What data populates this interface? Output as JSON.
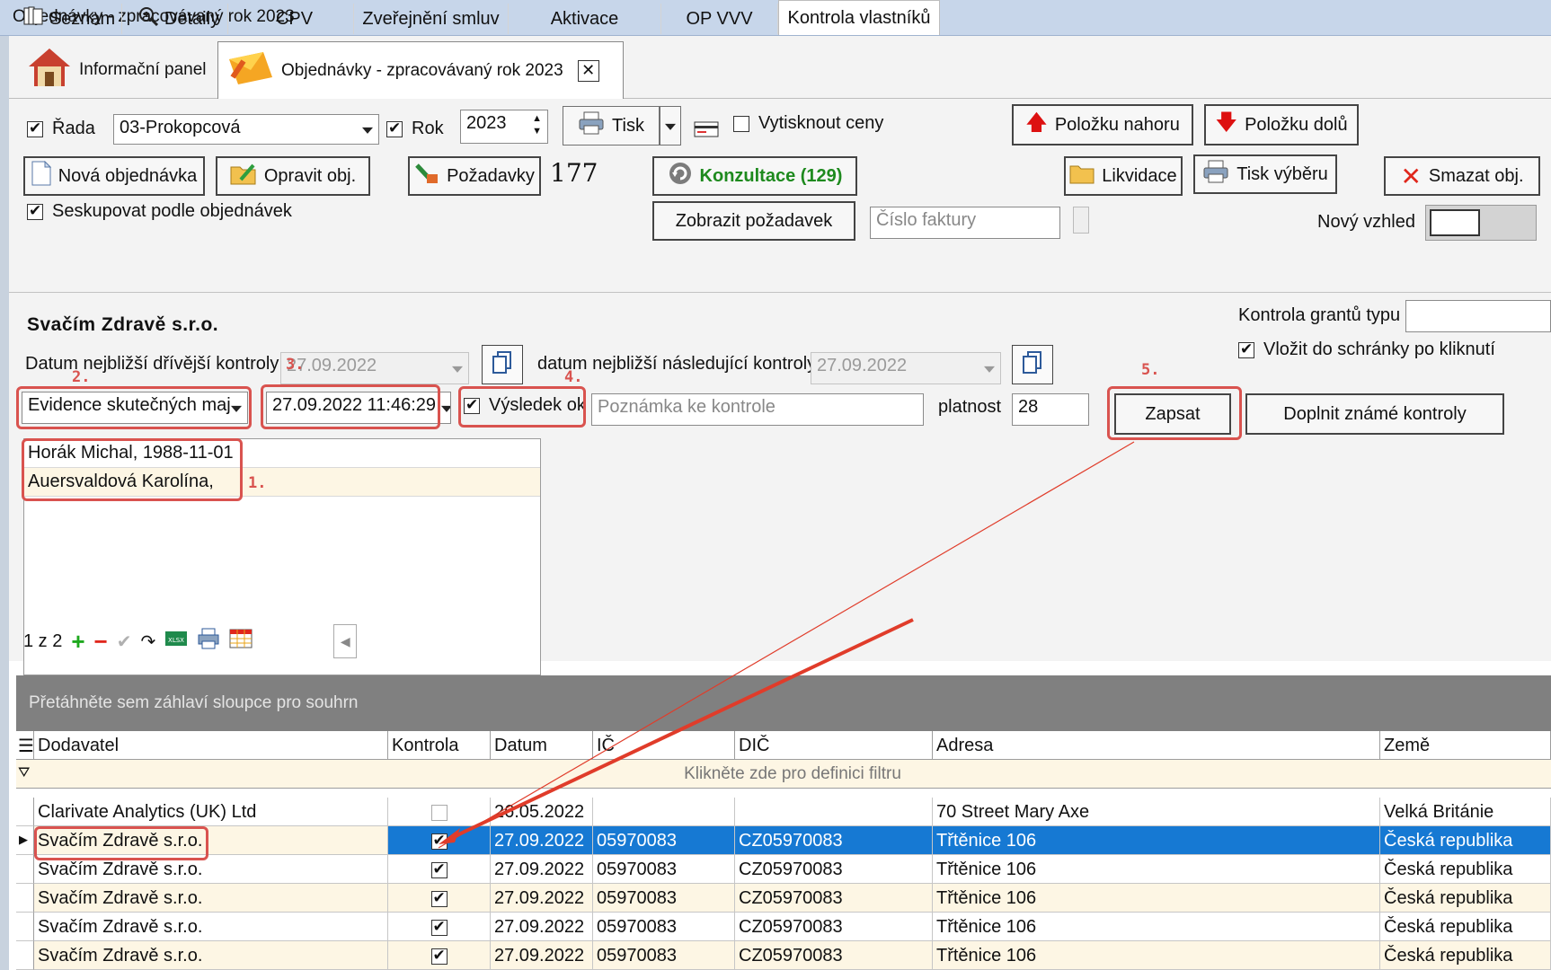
{
  "window": {
    "title": "Objednávky - zpracovávaný rok 2023"
  },
  "doc_tabs": {
    "info_panel": "Informační panel",
    "orders": "Objednávky - zpracovávaný rok 2023"
  },
  "toolbar": {
    "rada_label": "Řada",
    "rada_value": "03-Prokopcová",
    "rok_label": "Rok",
    "rok_value": "2023",
    "tisk": "Tisk",
    "vytisknout_ceny": "Vytisknout ceny",
    "polozku_nahoru": "Položku nahoru",
    "polozku_dolu": "Položku dolů",
    "nova_objednavka": "Nová objednávka",
    "opravit_obj": "Opravit obj.",
    "pozadavky": "Požadavky",
    "pozadavky_count": "177",
    "konzultace": "Konzultace (129)",
    "likvidace": "Likvidace",
    "tisk_vyberu": "Tisk výběru",
    "smazat_obj": "Smazat obj.",
    "seskupovat": "Seskupovat podle objednávek",
    "zobrazit_pozadavek": "Zobrazit požadavek",
    "cislo_faktury_placeholder": "Číslo faktury",
    "novy_vzhled": "Nový vzhled"
  },
  "tabs": [
    "Seznam",
    "Detaily",
    "CPV",
    "Zveřejnění smluv",
    "Aktivace",
    "OP VVV",
    "Kontrola vlastníků"
  ],
  "panel": {
    "company": "Svačím Zdravě s.r.o.",
    "prev_control_label": "Datum nejbližší dřívější kontroly",
    "prev_control_value": "27.09.2022",
    "next_control_label": "datum nejbližší následující kontroly",
    "next_control_value": "27.09.2022",
    "grant_type_label": "Kontrola grantů typu",
    "clipboard_label": "Vložit do schránky po kliknutí",
    "evidence_value": "Evidence skutečných maj",
    "datetime_value": "27.09.2022 11:46:29",
    "result_label": "Výsledek ok",
    "note_placeholder": "Poznámka ke kontrole",
    "platnost_label": "platnost",
    "platnost_value": "28",
    "zapsat": "Zapsat",
    "doplnit": "Doplnit známé kontroly",
    "owners": [
      "Horák Michal, 1988-11-01",
      "Auersvaldová Karolína,"
    ],
    "nav_count": "1 z 2"
  },
  "annotations": [
    "1.",
    "2.",
    "3.",
    "4.",
    "5."
  ],
  "grid": {
    "group_hint": "Přetáhněte sem záhlaví sloupce pro souhrn",
    "filter_hint": "Klikněte zde pro definici filtru",
    "columns": [
      "Dodavatel",
      "Kontrola",
      "Datum",
      "IČ",
      "DIČ",
      "Adresa",
      "Země"
    ],
    "rows": [
      {
        "dodavatel": "Clarivate Analytics (UK) Ltd",
        "kontrola": false,
        "datum": "26.05.2022",
        "ic": "",
        "dic": "",
        "adresa": "70 Street Mary Axe",
        "zeme": "Velká Británie"
      },
      {
        "dodavatel": "Svačím Zdravě s.r.o.",
        "kontrola": true,
        "datum": "27.09.2022",
        "ic": "05970083",
        "dic": "CZ05970083",
        "adresa": "Třtěnice 106",
        "zeme": "Česká republika"
      },
      {
        "dodavatel": "Svačím Zdravě s.r.o.",
        "kontrola": true,
        "datum": "27.09.2022",
        "ic": "05970083",
        "dic": "CZ05970083",
        "adresa": "Třtěnice 106",
        "zeme": "Česká republika"
      },
      {
        "dodavatel": "Svačím Zdravě s.r.o.",
        "kontrola": true,
        "datum": "27.09.2022",
        "ic": "05970083",
        "dic": "CZ05970083",
        "adresa": "Třtěnice 106",
        "zeme": "Česká republika"
      },
      {
        "dodavatel": "Svačím Zdravě s.r.o.",
        "kontrola": true,
        "datum": "27.09.2022",
        "ic": "05970083",
        "dic": "CZ05970083",
        "adresa": "Třtěnice 106",
        "zeme": "Česká republika"
      },
      {
        "dodavatel": "Svačím Zdravě s.r.o.",
        "kontrola": true,
        "datum": "27.09.2022",
        "ic": "05970083",
        "dic": "CZ05970083",
        "adresa": "Třtěnice 106",
        "zeme": "Česká republika"
      }
    ]
  },
  "colors": {
    "selection": "#1679d3",
    "annotation": "#d9534f",
    "alt_row": "#fdf6e4",
    "konzultace_text": "#1e8a1e"
  }
}
